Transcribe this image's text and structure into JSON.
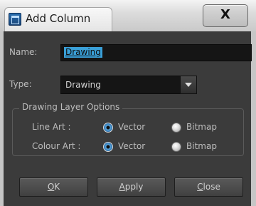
{
  "window": {
    "title": "Add Column",
    "close_symbol": "X"
  },
  "form": {
    "name_label": "Name:",
    "name_value": "Drawing",
    "type_label": "Type:",
    "type_value": "Drawing"
  },
  "layer_options": {
    "group_title": "Drawing Layer Options",
    "rows": [
      {
        "label": "Line Art :",
        "option1": "Vector",
        "option2": "Bitmap",
        "selected": "Vector"
      },
      {
        "label": "Colour Art :",
        "option1": "Vector",
        "option2": "Bitmap",
        "selected": "Vector"
      }
    ]
  },
  "buttons": {
    "ok": {
      "mnemonic": "O",
      "rest": "K"
    },
    "apply": {
      "mnemonic": "A",
      "rest": "pply"
    },
    "close": {
      "mnemonic": "C",
      "rest": "lose"
    }
  },
  "icons": {
    "app": "toon-boom-app-icon",
    "close": "close-icon",
    "dropdown": "chevron-down-icon"
  }
}
